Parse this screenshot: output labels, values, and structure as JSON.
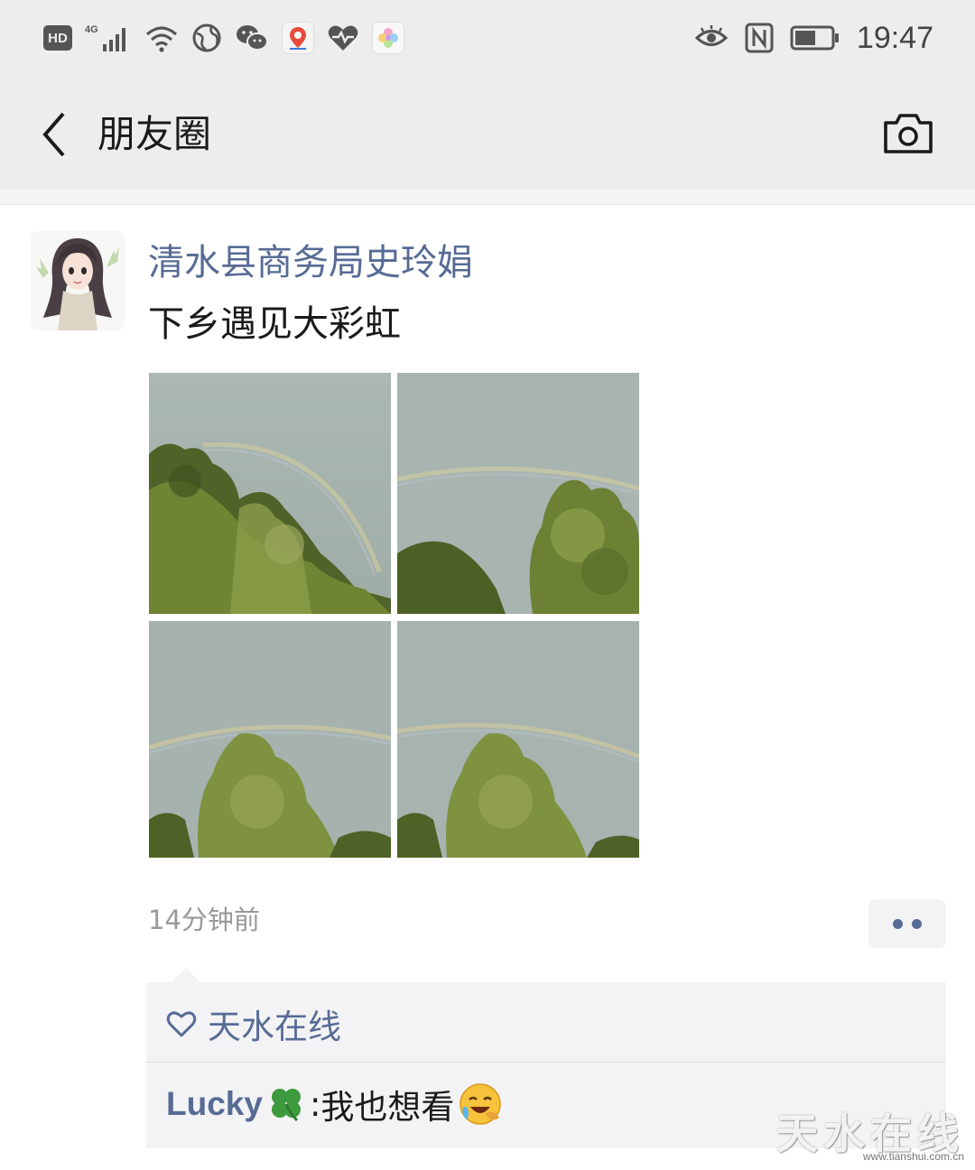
{
  "status_bar": {
    "network_badge": "HD",
    "network_type": "4G",
    "time": "19:47",
    "icons": [
      "hd-icon",
      "signal-icon",
      "wifi-icon",
      "globe-icon",
      "wechat-icon",
      "baidu-maps-icon",
      "health-icon",
      "gallery-icon",
      "eye-comfort-icon",
      "nfc-icon",
      "battery-icon"
    ]
  },
  "header": {
    "title": "朋友圈",
    "back_icon": "chevron-left-icon",
    "camera_icon": "camera-icon"
  },
  "post": {
    "author": "清水县商务局史玲娟",
    "text": "下乡遇见大彩虹",
    "timestamp": "14分钟前",
    "photos": [
      "rainbow-trees-photo-1",
      "rainbow-trees-photo-2",
      "rainbow-trees-photo-3",
      "rainbow-trees-photo-4"
    ],
    "more_icon": "more-dots-icon"
  },
  "likes": {
    "icon": "heart-outline-icon",
    "names": [
      "天水在线"
    ]
  },
  "comments": [
    {
      "author": "Lucky",
      "author_emoji": "four-leaf-clover-icon",
      "separator": ": ",
      "text": "我也想看",
      "trailing_emoji": "crying-laughing-emoji"
    }
  ],
  "watermark": {
    "text": "天水在线",
    "url": "www.tianshui.com.cn"
  },
  "colors": {
    "bar_bg": "#ededed",
    "link_blue": "#576b95",
    "comment_bg": "#f3f3f5",
    "meta_gray": "#999999"
  }
}
